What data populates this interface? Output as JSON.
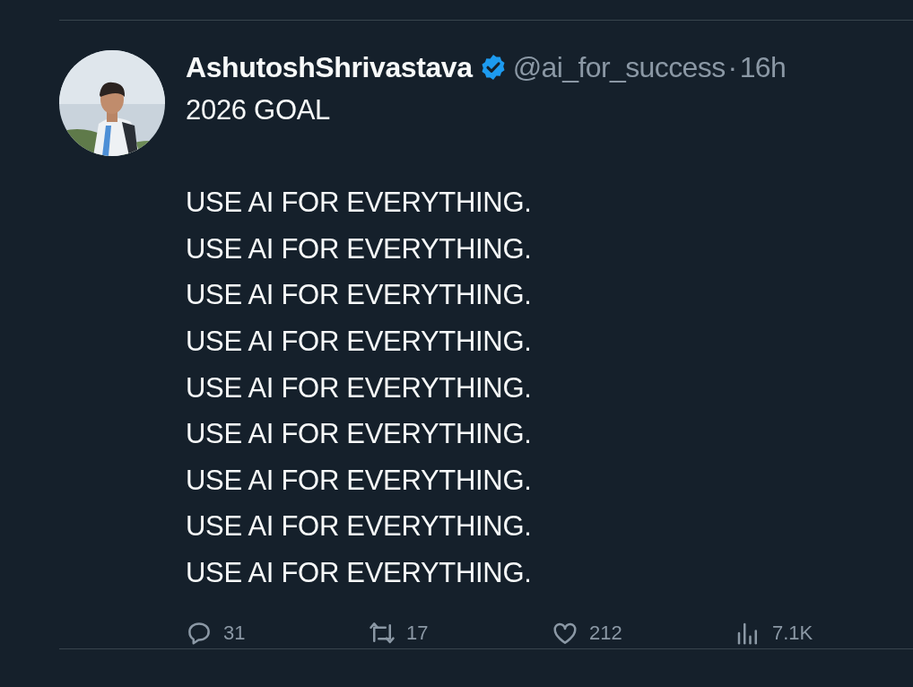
{
  "post": {
    "author": {
      "name": "AshutoshShrivastava",
      "verified": true,
      "handle": "@ai_for_success",
      "separator": "·",
      "time": "16h"
    },
    "headline": "2026 GOAL",
    "lines": [
      "USE AI FOR EVERYTHING.",
      "USE AI FOR EVERYTHING.",
      "USE AI FOR EVERYTHING.",
      "USE AI FOR EVERYTHING.",
      "USE AI FOR EVERYTHING.",
      "USE AI FOR EVERYTHING.",
      "USE AI FOR EVERYTHING.",
      "USE AI FOR EVERYTHING.",
      "USE AI FOR EVERYTHING."
    ],
    "actions": [
      {
        "kind": "reply",
        "count": "31"
      },
      {
        "kind": "repost",
        "count": "17"
      },
      {
        "kind": "like",
        "count": "212"
      },
      {
        "kind": "views",
        "count": "7.1K"
      }
    ]
  }
}
